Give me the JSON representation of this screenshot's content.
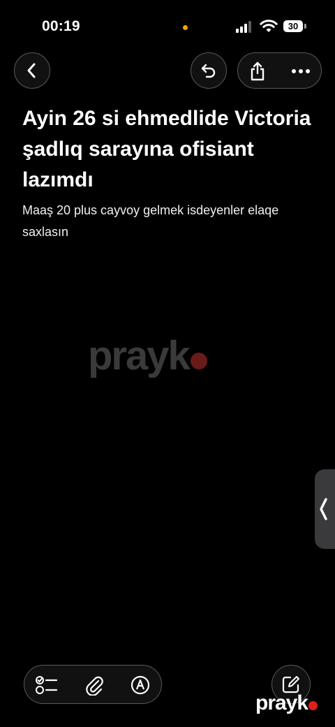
{
  "status_bar": {
    "time": "00:19",
    "battery": "30",
    "recording_dot_color": "#ff9f0a"
  },
  "nav": {
    "back_icon": "chevron-left-icon",
    "undo_icon": "undo-icon",
    "share_icon": "share-icon",
    "more_icon": "ellipsis-icon"
  },
  "note": {
    "title": "Ayin 26 si ehmedlide Victoria şadlıq sarayına ofisiant lazımdı",
    "body": "Maaş 20 plus cayvoy gelmek isdeyenler elaqe saxlasın"
  },
  "watermark": {
    "text": "prayk",
    "accent_color": "#e0201b"
  },
  "toolbar": {
    "checklist_icon": "checklist-icon",
    "attach_icon": "paperclip-icon",
    "markup_icon": "markup-pen-icon",
    "compose_icon": "compose-icon"
  }
}
